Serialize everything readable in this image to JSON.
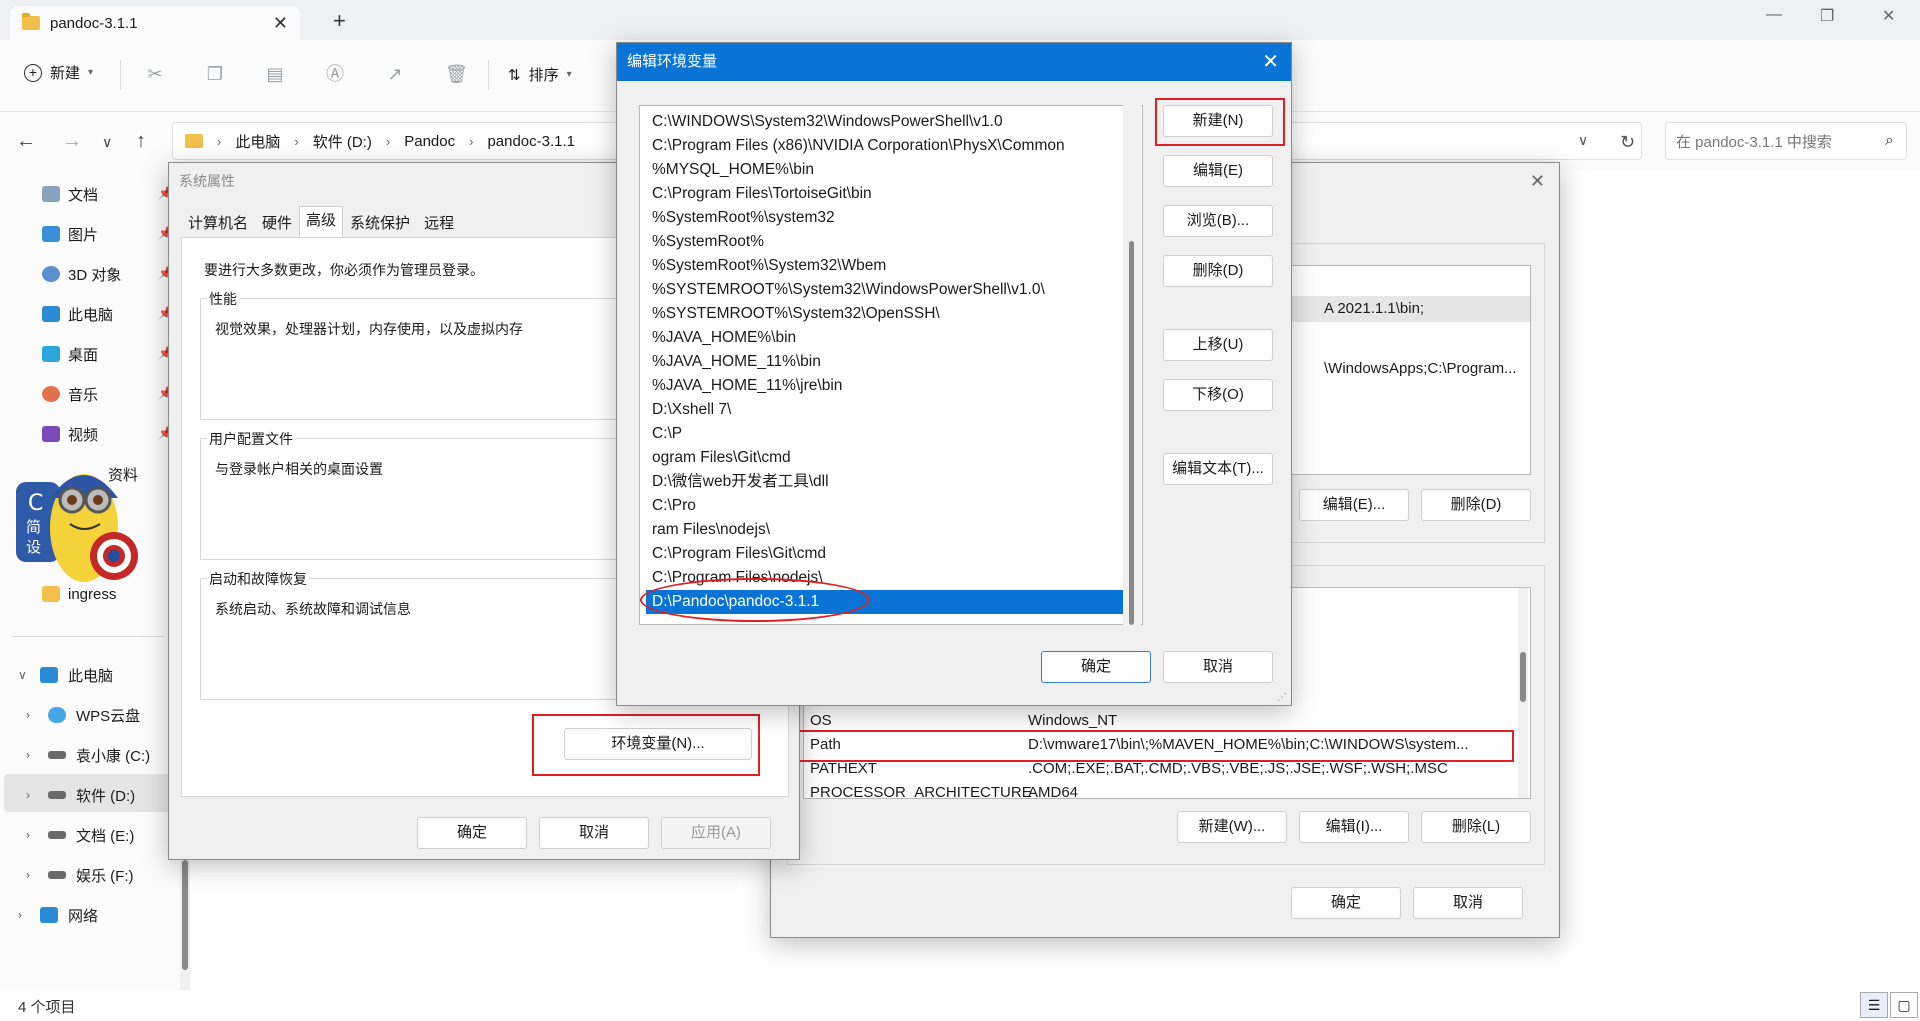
{
  "explorer": {
    "tab_title": "pandoc-3.1.1",
    "toolbar": {
      "new_label": "新建",
      "sort_label": "排序"
    },
    "breadcrumb": [
      "此电脑",
      "软件 (D:)",
      "Pandoc",
      "pandoc-3.1.1"
    ],
    "search_placeholder": "在 pandoc-3.1.1 中搜索",
    "quick_access": [
      {
        "label": "文档"
      },
      {
        "label": "图片"
      },
      {
        "label": "3D 对象"
      },
      {
        "label": "此电脑"
      },
      {
        "label": "桌面"
      },
      {
        "label": "音乐"
      },
      {
        "label": "视频"
      },
      {
        "label": "资料"
      },
      {
        "label": "ingress"
      }
    ],
    "tree": [
      {
        "label": "此电脑"
      },
      {
        "label": "WPS云盘"
      },
      {
        "label": "袁小康 (C:)"
      },
      {
        "label": "软件 (D:)"
      },
      {
        "label": "文档 (E:)"
      },
      {
        "label": "娱乐 (F:)"
      },
      {
        "label": "网络"
      }
    ],
    "status": "4 个项目"
  },
  "system_properties": {
    "title": "系统属性",
    "tabs": [
      "计算机名",
      "硬件",
      "高级",
      "系统保护",
      "远程"
    ],
    "active_tab": "高级",
    "admin_note": "要进行大多数更改，你必须作为管理员登录。",
    "performance": {
      "label": "性能",
      "desc": "视觉效果，处理器计划，内存使用，以及虚拟内存"
    },
    "user_profile": {
      "label": "用户配置文件",
      "desc": "与登录帐户相关的桌面设置"
    },
    "startup": {
      "label": "启动和故障恢复",
      "desc": "系统启动、系统故障和调试信息"
    },
    "env_button": "环境变量(N)...",
    "ok": "确定",
    "cancel": "取消",
    "apply": "应用(A)"
  },
  "env_vars": {
    "user_partial_1": "A 2021.1.1\\bin;",
    "user_partial_2": "\\WindowsApps;C:\\Program...",
    "user_edit": "编辑(E)...",
    "user_delete": "删除(D)",
    "system_rows": [
      {
        "name": "OS",
        "value": "Windows_NT"
      },
      {
        "name": "Path",
        "value": "D:\\vmware17\\bin\\;%MAVEN_HOME%\\bin;C:\\WINDOWS\\system..."
      },
      {
        "name": "PATHEXT",
        "value": ".COM;.EXE;.BAT;.CMD;.VBS;.VBE;.JS;.JSE;.WSF;.WSH;.MSC"
      },
      {
        "name": "PROCESSOR_ARCHITECTURE",
        "value": "AMD64"
      }
    ],
    "sys_new": "新建(W)...",
    "sys_edit": "编辑(I)...",
    "sys_delete": "删除(L)",
    "ok": "确定",
    "cancel": "取消"
  },
  "edit_env": {
    "title": "编辑环境变量",
    "paths": [
      "C:\\WINDOWS\\System32\\WindowsPowerShell\\v1.0",
      "C:\\Program Files (x86)\\NVIDIA Corporation\\PhysX\\Common",
      "%MYSQL_HOME%\\bin",
      "C:\\Program Files\\TortoiseGit\\bin",
      "%SystemRoot%\\system32",
      "%SystemRoot%",
      "%SystemRoot%\\System32\\Wbem",
      "%SYSTEMROOT%\\System32\\WindowsPowerShell\\v1.0\\",
      "%SYSTEMROOT%\\System32\\OpenSSH\\",
      "%JAVA_HOME%\\bin",
      "%JAVA_HOME_11%\\bin",
      "%JAVA_HOME_11%\\jre\\bin",
      "D:\\Xshell 7\\",
      "C:\\P",
      "ogram Files\\Git\\cmd",
      "D:\\微信web开发者工具\\dll",
      "C:\\Pro",
      "ram Files\\nodejs\\",
      "C:\\Program Files\\Git\\cmd",
      "C:\\Program Files\\nodejs\\",
      "D:\\Pandoc\\pandoc-3.1.1"
    ],
    "selected_index": 20,
    "buttons": {
      "new": "新建(N)",
      "edit": "编辑(E)",
      "browse": "浏览(B)...",
      "delete": "删除(D)",
      "up": "上移(U)",
      "down": "下移(O)",
      "edit_text": "编辑文本(T)...",
      "ok": "确定",
      "cancel": "取消"
    }
  },
  "colors": {
    "accent": "#0a74d6",
    "highlight_red": "#e02020",
    "folder": "#f3c04c"
  }
}
